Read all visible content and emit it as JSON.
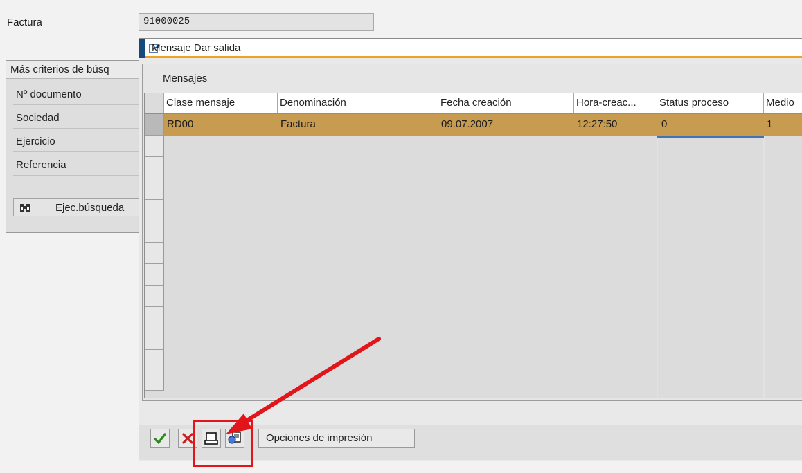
{
  "background": {
    "factura_label": "Factura",
    "factura_value": "91000025",
    "criteria_title": "Más criterios de búsq",
    "criteria_items": [
      "Nº documento",
      "Sociedad",
      "Ejercicio",
      "Referencia"
    ],
    "search_button": "Ejec.búsqueda"
  },
  "dialog": {
    "title": "Mensaje Dar salida",
    "section_label": "Mensajes",
    "columns": [
      "Clase mensaje",
      "Denominación",
      "Fecha creación",
      "Hora-creac...",
      "Status proceso",
      "Medio"
    ],
    "rows": [
      [
        "RD00",
        "Factura",
        "09.07.2007",
        "12:27:50",
        "0",
        "1"
      ]
    ],
    "print_options_button": "Opciones de impresión",
    "icons": [
      "confirm-icon",
      "cancel-icon",
      "print-icon",
      "print-preview-icon"
    ],
    "colors": {
      "selected_row": "#c79c50",
      "title_underline": "#f0a024",
      "highlight": "#e2151b"
    }
  }
}
